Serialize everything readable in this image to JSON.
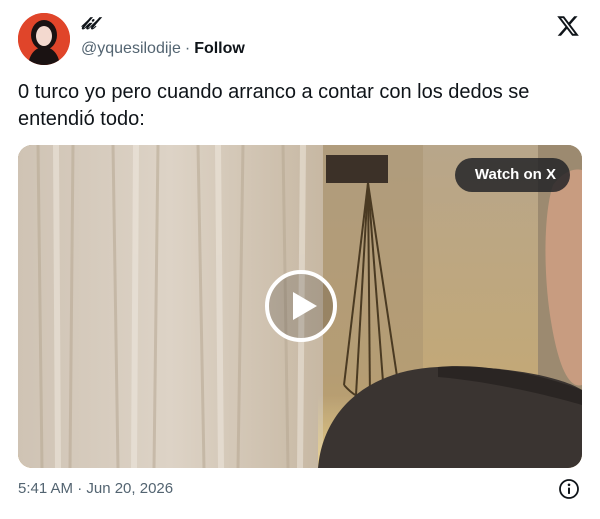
{
  "author": {
    "display_name": "𝓁𝒾𝓁",
    "handle": "@yquesilodije",
    "separator": "·",
    "follow_label": "Follow",
    "avatar_icon": "profile-avatar"
  },
  "tweet": {
    "text": "0 turco yo pero cuando arranco a contar con los dedos se entendió todo:",
    "timestamp": "5:41 AM · Jun 20, 2026"
  },
  "media": {
    "watch_label": "Watch on X",
    "play_icon": "play-icon"
  },
  "icons": {
    "brand": "x-logo-icon",
    "info": "info-icon"
  },
  "colors": {
    "text": "#0f1419",
    "secondary": "#536471",
    "avatar_bg": "#e0452a"
  }
}
